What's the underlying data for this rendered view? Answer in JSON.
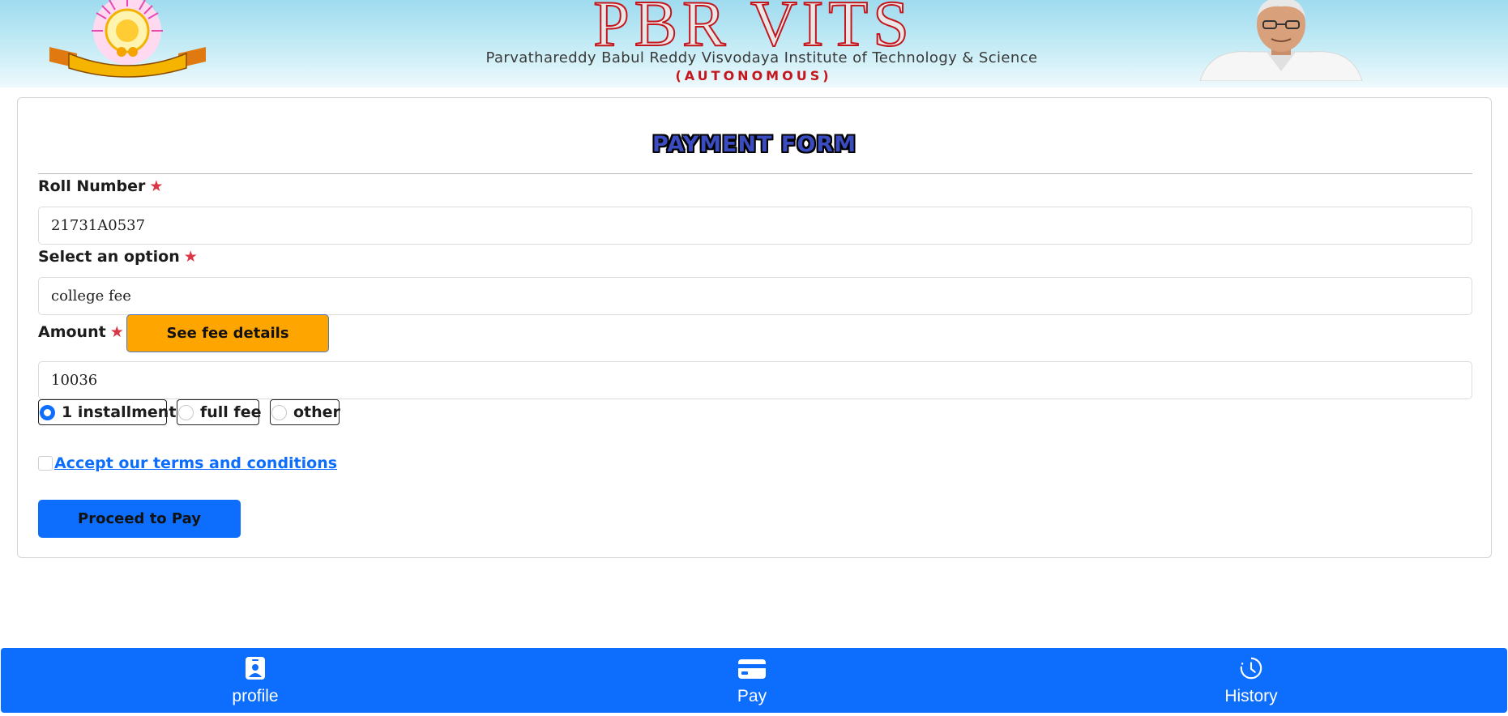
{
  "header": {
    "title": "PBR VITS",
    "subtitle": "Parvathareddy Babul Reddy Visvodaya Institute of Technology & Science",
    "status": "(AUTONOMOUS)",
    "logo_icon": "college-emblem-icon",
    "portrait_icon": "founder-portrait"
  },
  "form": {
    "title": "PAYMENT FORM",
    "required_marker": "★",
    "roll_number": {
      "label": "Roll Number",
      "value": "21731A0537"
    },
    "option": {
      "label": "Select an option",
      "value": "college fee"
    },
    "amount": {
      "label": "Amount",
      "value": "10036"
    },
    "fee_details_button": "See fee details",
    "installment_options": [
      {
        "label": "1 installment",
        "selected": true
      },
      {
        "label": "full fee",
        "selected": false
      },
      {
        "label": "other",
        "selected": false
      }
    ],
    "terms_label": "Accept our terms and conditions",
    "terms_checked": false,
    "submit_button": "Proceed to Pay"
  },
  "bottom_nav": {
    "items": [
      {
        "label": "profile",
        "icon": "badge-icon"
      },
      {
        "label": "Pay",
        "icon": "credit-card-icon"
      },
      {
        "label": "History",
        "icon": "clock-history-icon"
      }
    ]
  },
  "colors": {
    "primary": "#0d6efd",
    "warning": "#ffa500",
    "required": "#dc3545",
    "brand_red": "#c4161c"
  }
}
